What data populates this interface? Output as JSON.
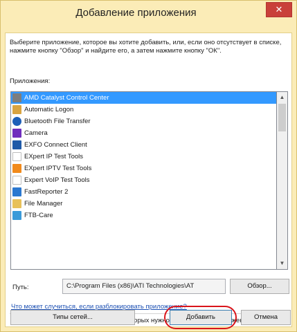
{
  "window": {
    "title": "Добавление приложения",
    "close_glyph": "✕"
  },
  "instructions": "Выберите приложение, которое вы хотите добавить, или, если оно отсутствует в списке, нажмите кнопку \"Обзор\" и найдите его, а затем нажмите кнопку \"ОК\".",
  "apps_label": "Приложения:",
  "apps": [
    {
      "label": "AMD Catalyst Control Center",
      "icon": "amd-catalyst-icon",
      "selected": true
    },
    {
      "label": "Automatic Logon",
      "icon": "users-icon"
    },
    {
      "label": "Bluetooth File Transfer",
      "icon": "bluetooth-icon"
    },
    {
      "label": "Camera",
      "icon": "camera-icon"
    },
    {
      "label": "EXFO Connect Client",
      "icon": "exfo-icon"
    },
    {
      "label": "EXpert IP Test Tools",
      "icon": "document-icon"
    },
    {
      "label": "EXpert IPTV Test Tools",
      "icon": "iptv-icon"
    },
    {
      "label": "Expert VoIP Test Tools",
      "icon": "document-icon"
    },
    {
      "label": "FastReporter 2",
      "icon": "fastreporter-icon"
    },
    {
      "label": "File Manager",
      "icon": "folder-icon"
    },
    {
      "label": "FTB-Care",
      "icon": "ftb-care-icon"
    }
  ],
  "scroll": {
    "up_glyph": "▲",
    "down_glyph": "▼"
  },
  "path": {
    "label": "Путь:",
    "value": "C:\\Program Files (x86)\\ATI Technologies\\AT"
  },
  "browse_label": "Обзор...",
  "link_text": "Что может случиться, если разблокировать приложение?",
  "network_note": "Вы можете выбрать типы сетей, для которых нужно добавить это приложение.",
  "buttons": {
    "network_types": "Типы сетей...",
    "add": "Добавить",
    "cancel": "Отмена"
  },
  "colors": {
    "frame": "#fbecb7",
    "close": "#c9403a",
    "selection": "#3399ff",
    "highlight_ring": "#d9141a",
    "link": "#1b4fb3"
  }
}
